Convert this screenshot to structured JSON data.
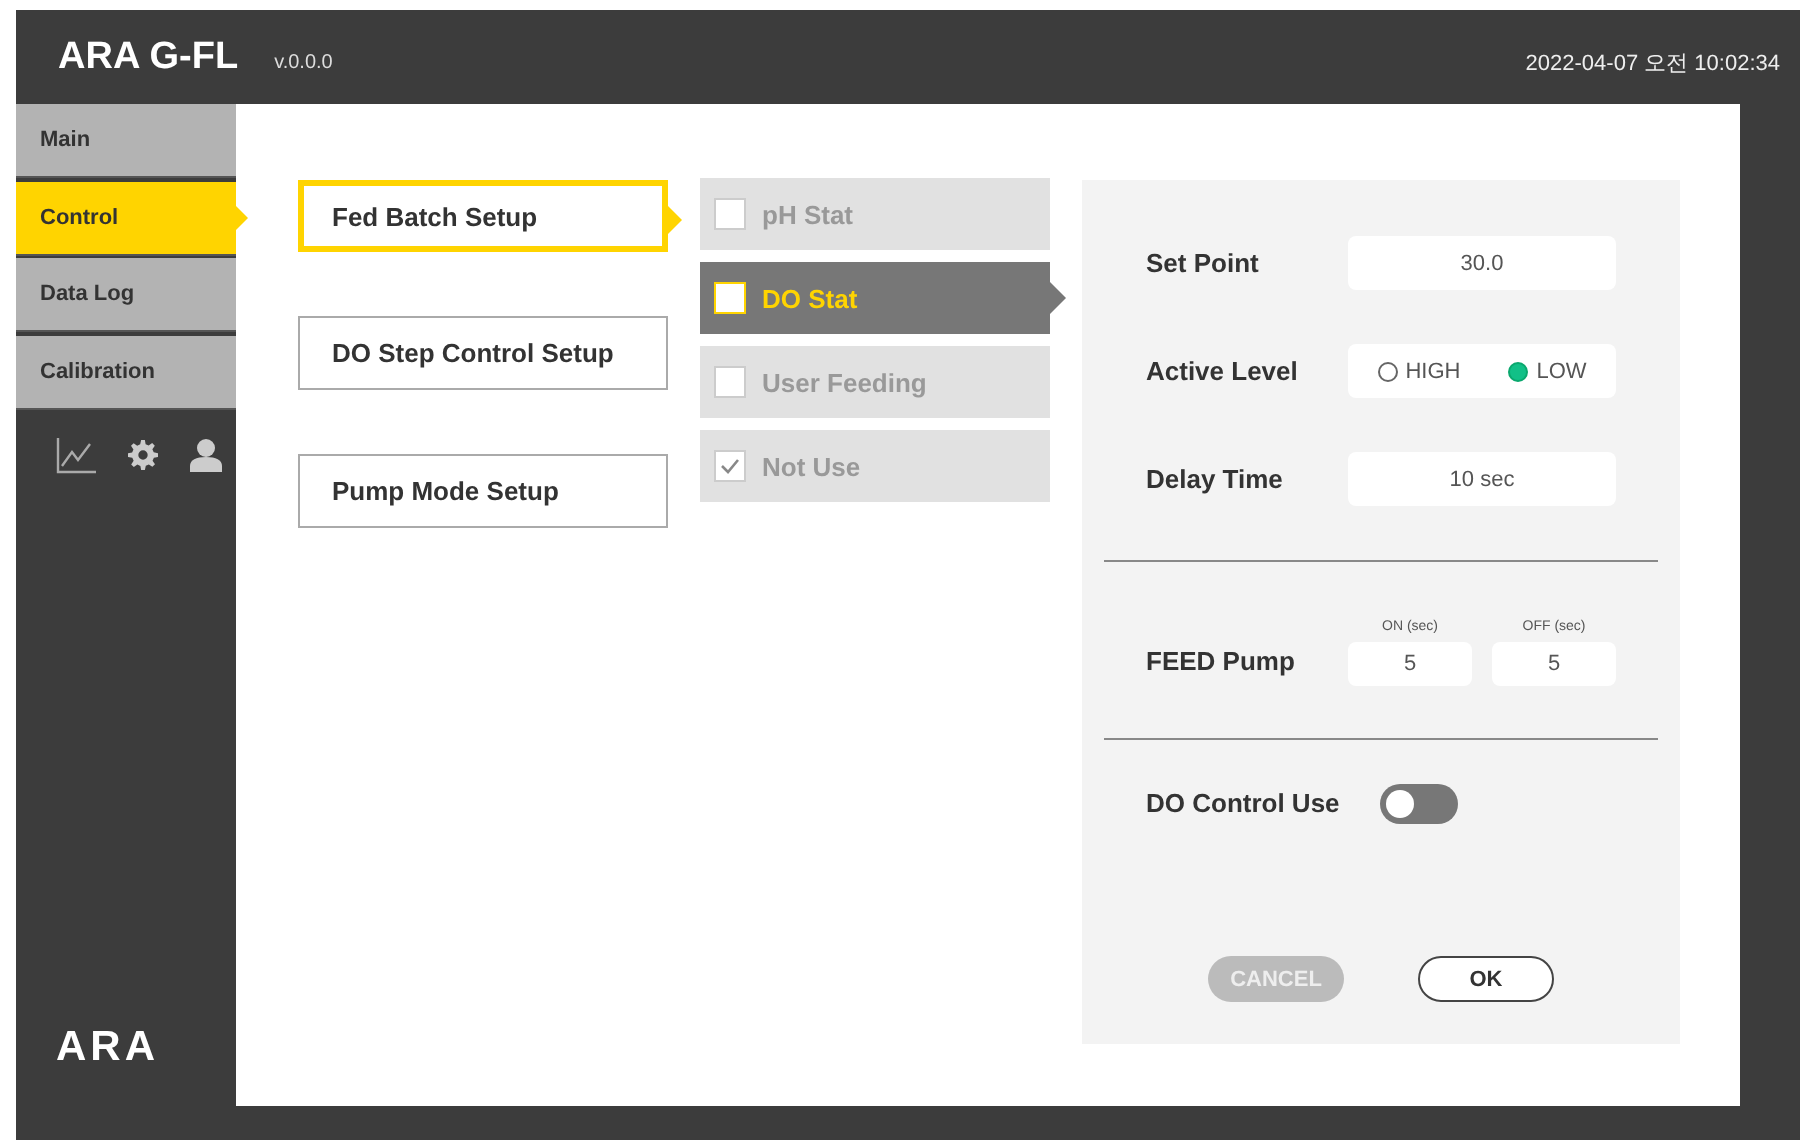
{
  "header": {
    "title": "ARA G-FL",
    "version": "v.0.0.0",
    "datetime": "2022-04-07 오전 10:02:34"
  },
  "sidebar": {
    "items": [
      {
        "label": "Main",
        "selected": false
      },
      {
        "label": "Control",
        "selected": true
      },
      {
        "label": "Data Log",
        "selected": false
      },
      {
        "label": "Calibration",
        "selected": false
      }
    ],
    "logo": "ARA"
  },
  "menus": [
    {
      "label": "Fed Batch Setup",
      "selected": true
    },
    {
      "label": "DO Step Control Setup",
      "selected": false
    },
    {
      "label": "Pump Mode Setup",
      "selected": false
    }
  ],
  "options": [
    {
      "label": "pH Stat",
      "checked": false,
      "selected": false
    },
    {
      "label": "DO Stat",
      "checked": false,
      "selected": true
    },
    {
      "label": "User Feeding",
      "checked": false,
      "selected": false
    },
    {
      "label": "Not Use",
      "checked": true,
      "selected": false
    }
  ],
  "form": {
    "set_point": {
      "label": "Set Point",
      "value": "30.0"
    },
    "active_level": {
      "label": "Active Level",
      "options": [
        {
          "label": "HIGH",
          "selected": false
        },
        {
          "label": "LOW",
          "selected": true
        }
      ]
    },
    "delay_time": {
      "label": "Delay Time",
      "value": "10 sec"
    },
    "feed_pump": {
      "label": "FEED Pump",
      "on_label": "ON (sec)",
      "on_value": "5",
      "off_label": "OFF (sec)",
      "off_value": "5"
    },
    "do_control": {
      "label": "DO Control Use",
      "on": false
    }
  },
  "buttons": [
    {
      "label": "CANCEL",
      "kind": "secondary"
    },
    {
      "label": "OK",
      "kind": "primary"
    }
  ]
}
